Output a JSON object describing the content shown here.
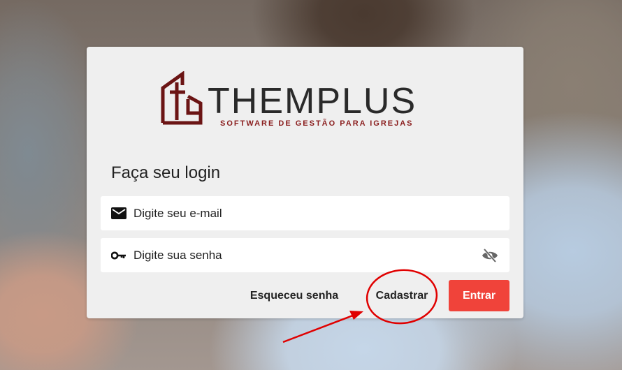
{
  "brand": {
    "name": "THEMPLUS",
    "tagline": "SOFTWARE DE GESTÃO PARA IGREJAS",
    "logo_color": "#6b1414"
  },
  "login": {
    "title": "Faça seu login",
    "email_placeholder": "Digite seu e-mail",
    "password_placeholder": "Digite sua senha",
    "forgot_label": "Esqueceu senha",
    "register_label": "Cadastrar",
    "submit_label": "Entrar",
    "submit_color": "#f0433a"
  },
  "icons": {
    "email": "envelope-icon",
    "password": "key-icon",
    "toggle": "eye-slash-icon"
  },
  "annotation": {
    "color": "#e00000",
    "highlighted": "register-button"
  }
}
